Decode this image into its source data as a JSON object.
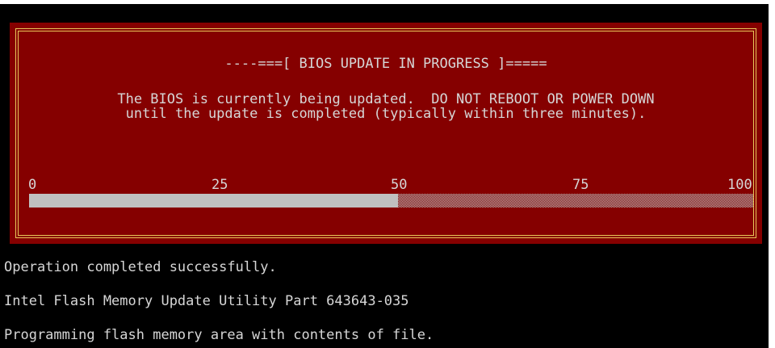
{
  "dialog": {
    "title": "----===[ BIOS UPDATE IN PROGRESS ]=====",
    "message_line1": "The BIOS is currently being updated.  DO NOT REBOOT OR POWER DOWN",
    "message_line2": "until the update is completed (typically within three minutes).",
    "scale_labels": [
      "0",
      "25",
      "50",
      "75",
      "100"
    ],
    "progress_percent": 51,
    "colors": {
      "background": "#850000",
      "border": "#e8c85a",
      "text": "#d6d6d6",
      "bar_fill": "#c0c0c0"
    }
  },
  "console": {
    "lines": [
      "Operation completed successfully.",
      "Intel Flash Memory Update Utility Part 643643-035",
      "Programming flash memory area with contents of file."
    ]
  }
}
